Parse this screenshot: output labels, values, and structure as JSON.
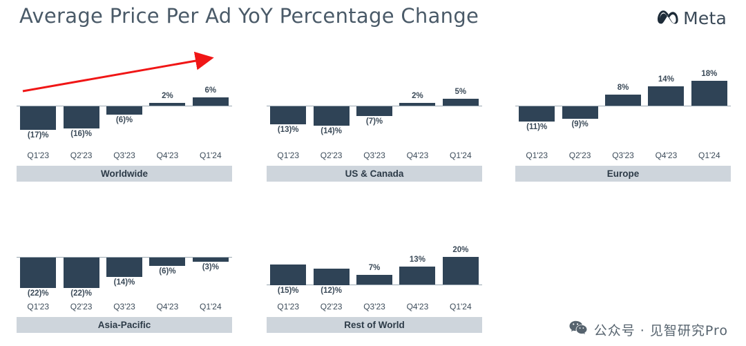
{
  "header": {
    "title": "Average Price Per Ad YoY Percentage Change",
    "brand": "Meta",
    "brand_icon": "meta-infinity-icon"
  },
  "watermark": {
    "text": "公众号 · 见智研究Pro",
    "icon": "wechat-icon"
  },
  "annotations": {
    "arrow": "red-upward-trend-arrow"
  },
  "chart_data": [
    {
      "type": "bar",
      "title": "Worldwide",
      "categories": [
        "Q1'23",
        "Q2'23",
        "Q3'23",
        "Q4'23",
        "Q1'24"
      ],
      "values": [
        -17,
        -16,
        -6,
        2,
        6
      ],
      "labels": [
        "(17)%",
        "(16)%",
        "(6)%",
        "2%",
        "6%"
      ],
      "xlabel": "",
      "ylabel": "",
      "ylim": [
        -22,
        20
      ],
      "grid": false,
      "legend": "none"
    },
    {
      "type": "bar",
      "title": "US & Canada",
      "categories": [
        "Q1'23",
        "Q2'23",
        "Q3'23",
        "Q4'23",
        "Q1'24"
      ],
      "values": [
        -13,
        -14,
        -7,
        2,
        5
      ],
      "labels": [
        "(13)%",
        "(14)%",
        "(7)%",
        "2%",
        "5%"
      ],
      "xlabel": "",
      "ylabel": "",
      "ylim": [
        -22,
        20
      ],
      "grid": false,
      "legend": "none"
    },
    {
      "type": "bar",
      "title": "Europe",
      "categories": [
        "Q1'23",
        "Q2'23",
        "Q3'23",
        "Q4'23",
        "Q1'24"
      ],
      "values": [
        -11,
        -9,
        8,
        14,
        18
      ],
      "labels": [
        "(11)%",
        "(9)%",
        "8%",
        "14%",
        "18%"
      ],
      "xlabel": "",
      "ylabel": "",
      "ylim": [
        -22,
        20
      ],
      "grid": false,
      "legend": "none"
    },
    {
      "type": "bar",
      "title": "Asia-Pacific",
      "categories": [
        "Q1'23",
        "Q2'23",
        "Q3'23",
        "Q4'23",
        "Q1'24"
      ],
      "values": [
        -22,
        -22,
        -14,
        -6,
        -3
      ],
      "labels": [
        "(22)%",
        "(22)%",
        "(14)%",
        "(6)%",
        "(3)%"
      ],
      "xlabel": "",
      "ylabel": "",
      "ylim": [
        -22,
        20
      ],
      "grid": false,
      "legend": "none"
    },
    {
      "type": "bar",
      "title": "Rest of World",
      "categories": [
        "Q1'23",
        "Q2'23",
        "Q3'23",
        "Q4'23",
        "Q1'24"
      ],
      "values": [
        -15,
        -12,
        7,
        13,
        20
      ],
      "labels": [
        "(15)%",
        "(12)%",
        "7%",
        "13%",
        "20%"
      ],
      "xlabel": "",
      "ylabel": "",
      "ylim": [
        -22,
        20
      ],
      "grid": false,
      "legend": "none"
    }
  ],
  "colors": {
    "bar": "#2f4356",
    "region_band": "#ced5dc",
    "axis": "#9aa7b2",
    "title": "#4a5a68",
    "arrow": "#f01616"
  }
}
